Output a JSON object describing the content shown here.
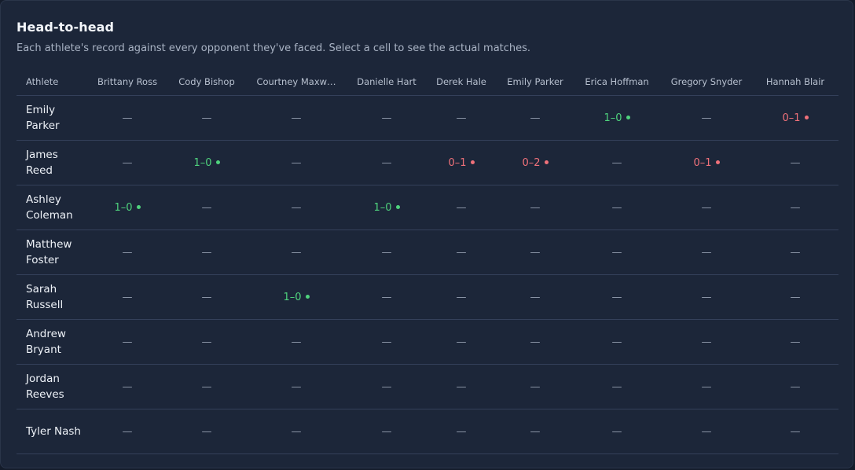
{
  "title": "Head-to-head",
  "subtitle": "Each athlete's record against every opponent they've faced. Select a cell to see the actual matches.",
  "colors": {
    "win": "#4fd37d",
    "loss": "#f0717a",
    "empty": "#8e98aa",
    "panel": "#1c2639"
  },
  "table": {
    "athlete_header": "Athlete",
    "columns": [
      "Brittany Ross",
      "Cody Bishop",
      "Courtney Maxw…",
      "Danielle Hart",
      "Derek Hale",
      "Emily Parker",
      "Erica Hoffman",
      "Gregory Snyder",
      "Hannah Blair"
    ],
    "rows": [
      {
        "athlete": "Emily Parker",
        "cells": [
          "—",
          "—",
          "—",
          "—",
          "—",
          "—",
          "1–0",
          "—",
          "0–1"
        ],
        "results": [
          "",
          "",
          "",
          "",
          "",
          "",
          "win",
          "",
          "loss"
        ]
      },
      {
        "athlete": "James Reed",
        "cells": [
          "—",
          "1–0",
          "—",
          "—",
          "0–1",
          "0–2",
          "—",
          "0–1",
          "—"
        ],
        "results": [
          "",
          "win",
          "",
          "",
          "loss",
          "loss",
          "",
          "loss",
          ""
        ]
      },
      {
        "athlete": "Ashley Coleman",
        "cells": [
          "1–0",
          "—",
          "—",
          "1–0",
          "—",
          "—",
          "—",
          "—",
          "—"
        ],
        "results": [
          "win",
          "",
          "",
          "win",
          "",
          "",
          "",
          "",
          ""
        ]
      },
      {
        "athlete": "Matthew Foster",
        "cells": [
          "—",
          "—",
          "—",
          "—",
          "—",
          "—",
          "—",
          "—",
          "—"
        ],
        "results": [
          "",
          "",
          "",
          "",
          "",
          "",
          "",
          "",
          ""
        ]
      },
      {
        "athlete": "Sarah Russell",
        "cells": [
          "—",
          "—",
          "1–0",
          "—",
          "—",
          "—",
          "—",
          "—",
          "—"
        ],
        "results": [
          "",
          "",
          "win",
          "",
          "",
          "",
          "",
          "",
          ""
        ]
      },
      {
        "athlete": "Andrew Bryant",
        "cells": [
          "—",
          "—",
          "—",
          "—",
          "—",
          "—",
          "—",
          "—",
          "—"
        ],
        "results": [
          "",
          "",
          "",
          "",
          "",
          "",
          "",
          "",
          ""
        ]
      },
      {
        "athlete": "Jordan Reeves",
        "cells": [
          "—",
          "—",
          "—",
          "—",
          "—",
          "—",
          "—",
          "—",
          "—"
        ],
        "results": [
          "",
          "",
          "",
          "",
          "",
          "",
          "",
          "",
          ""
        ]
      },
      {
        "athlete": "Tyler Nash",
        "cells": [
          "—",
          "—",
          "—",
          "—",
          "—",
          "—",
          "—",
          "—",
          "—"
        ],
        "results": [
          "",
          "",
          "",
          "",
          "",
          "",
          "",
          "",
          ""
        ]
      }
    ]
  }
}
